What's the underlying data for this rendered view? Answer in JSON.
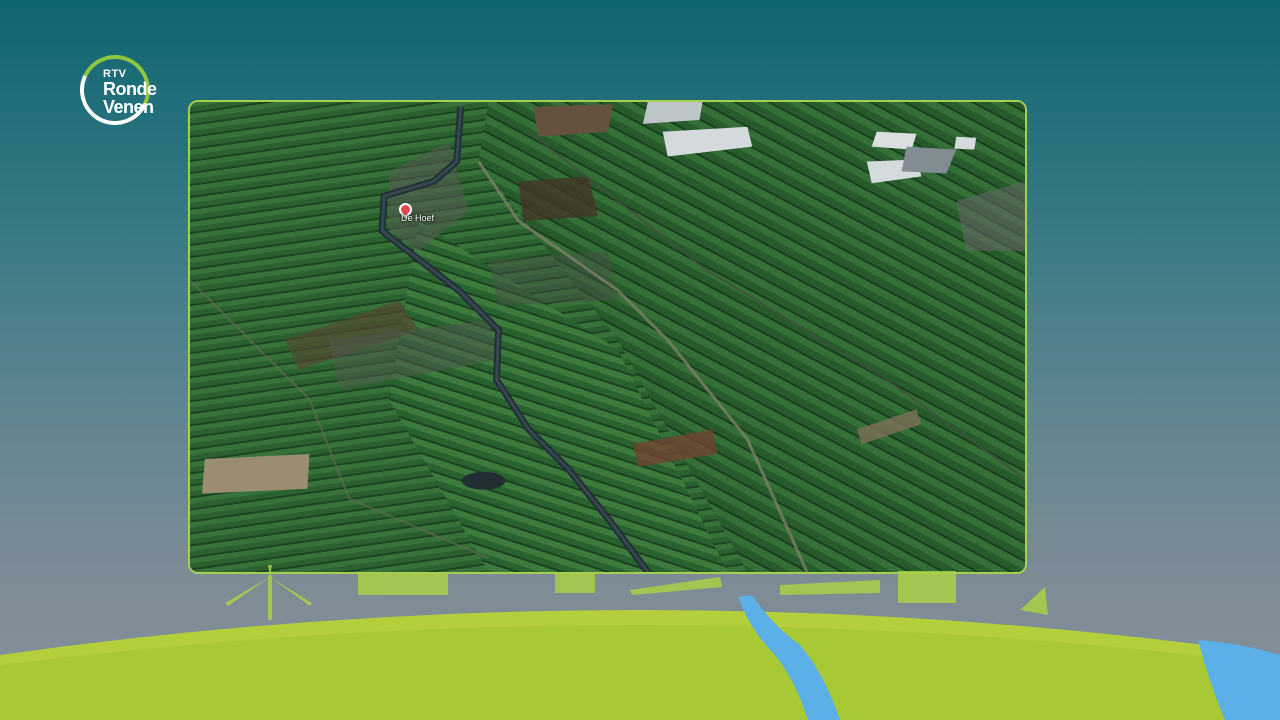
{
  "brand": {
    "name_prefix": "RTV",
    "name_line1": "Ronde",
    "name_line2": "Venen",
    "accent_color": "#8dc63f"
  },
  "map": {
    "place_label": "De Hoef",
    "marker_icon": "map-pin-icon",
    "frame_color": "#a5cf52"
  }
}
